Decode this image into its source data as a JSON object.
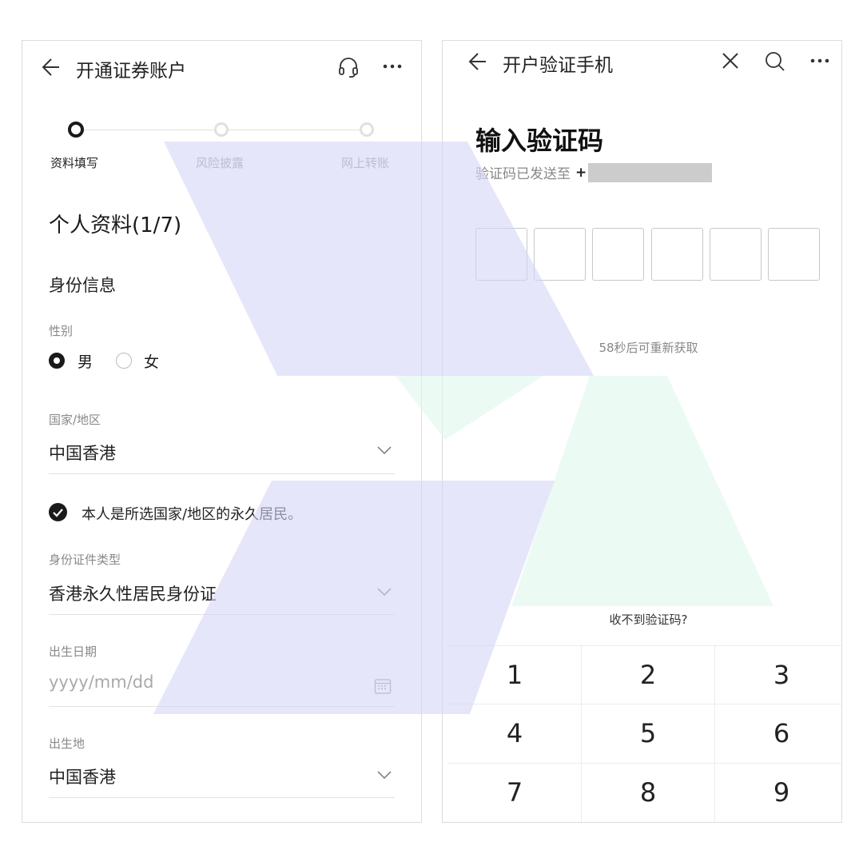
{
  "left": {
    "header": {
      "title": "开通证券账户",
      "support_icon": "headset-icon",
      "more_icon": "more-dots-icon",
      "back_icon": "back-arrow-icon"
    },
    "steps": [
      {
        "label": "资料填写",
        "state": "active"
      },
      {
        "label": "风险披露",
        "state": "pending"
      },
      {
        "label": "网上转账",
        "state": "pending"
      }
    ],
    "section_title": "个人资料(1/7)",
    "subsection_title": "身份信息",
    "gender": {
      "label": "性别",
      "options": [
        "男",
        "女"
      ],
      "selected": "男"
    },
    "country": {
      "label": "国家/地区",
      "value": "中国香港"
    },
    "permanent_resident": {
      "text": "本人是所选国家/地区的永久居民。",
      "checked": true
    },
    "id_type": {
      "label": "身份证件类型",
      "value": "香港永久性居民身份证"
    },
    "birth_date": {
      "label": "出生日期",
      "placeholder": "yyyy/mm/dd"
    },
    "birth_place": {
      "label": "出生地",
      "value": "中国香港"
    }
  },
  "right": {
    "header": {
      "title": "开户验证手机",
      "back_icon": "back-arrow-icon",
      "close_icon": "close-icon",
      "search_icon": "search-icon",
      "more_icon": "more-dots-icon"
    },
    "heading": "输入验证码",
    "sent_to_label": "验证码已发送至",
    "sent_to_prefix": "+",
    "resend_text": "58秒后可重新获取",
    "no_code_link": "收不到验证码?",
    "keypad": [
      "1",
      "2",
      "3",
      "4",
      "5",
      "6",
      "7",
      "8",
      "9"
    ]
  },
  "colors": {
    "overlay_blue": "#e6e6fa",
    "overlay_green": "#edfbf4",
    "accent_dark": "#1a1a1a",
    "muted": "#888888"
  }
}
